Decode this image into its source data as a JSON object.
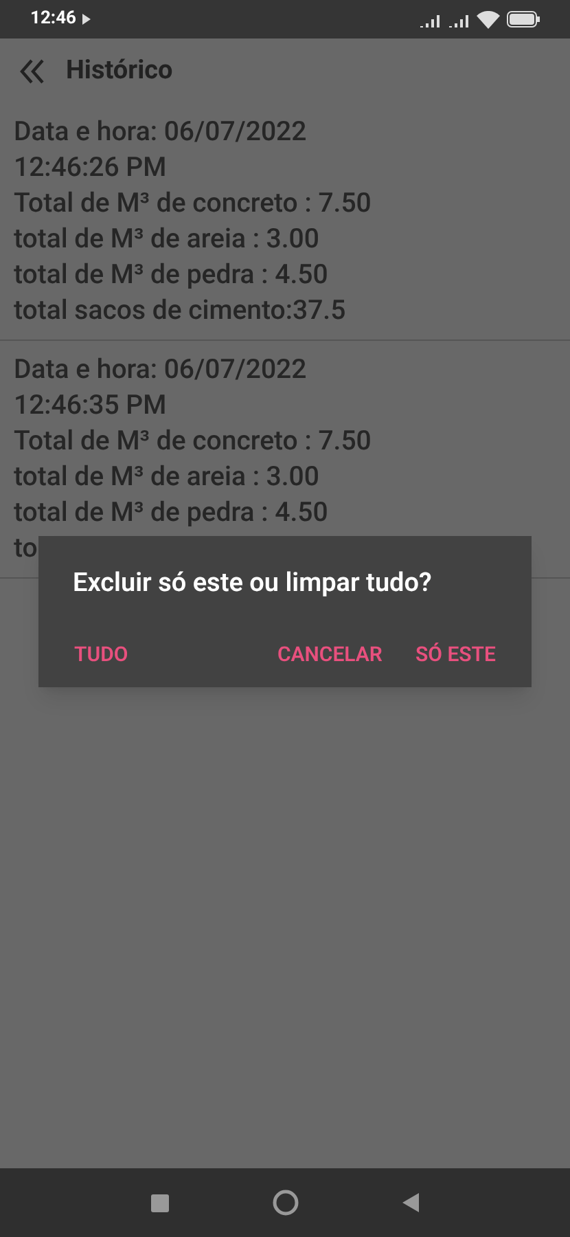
{
  "status_bar": {
    "time": "12:46"
  },
  "app_bar": {
    "title": "Histórico"
  },
  "records": [
    {
      "lines": [
        "Data e hora: 06/07/2022",
        "12:46:26 PM",
        "Total de M³ de concreto : 7.50",
        "total de M³ de areia : 3.00",
        "total de M³ de pedra : 4.50",
        "total sacos de cimento:37.5"
      ]
    },
    {
      "lines": [
        "Data e hora: 06/07/2022",
        "12:46:35 PM",
        "Total de M³ de concreto : 7.50",
        "total de M³ de areia : 3.00",
        "total de M³ de pedra : 4.50",
        "to"
      ]
    }
  ],
  "dialog": {
    "message": "Excluir só este ou limpar tudo?",
    "buttons": [
      "TUDO",
      "CANCELAR",
      "SÓ ESTE"
    ]
  }
}
